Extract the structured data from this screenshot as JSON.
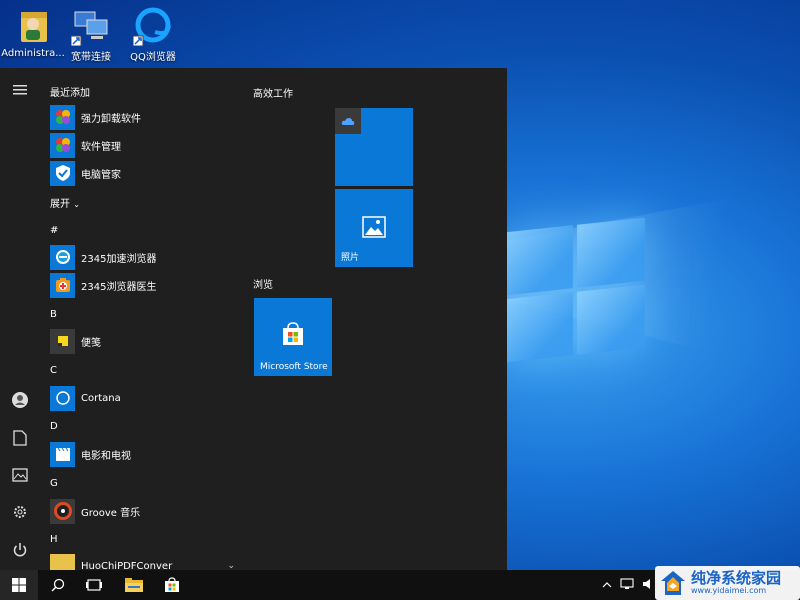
{
  "desktop": {
    "icons": [
      {
        "label": "Administra...",
        "icon": "user-folder-icon"
      },
      {
        "label": "宽带连接",
        "icon": "network-icon"
      },
      {
        "label": "QQ浏览器",
        "icon": "qq-browser-icon"
      }
    ]
  },
  "start_menu": {
    "rail": {
      "items": [
        "hamburger-menu-icon",
        "user-icon",
        "documents-icon",
        "pictures-icon",
        "settings-icon",
        "power-icon"
      ]
    },
    "app_list": {
      "recent_header": "最近添加",
      "recent": [
        {
          "label": "强力卸载软件",
          "icon": "uninstaller-icon"
        },
        {
          "label": "软件管理",
          "icon": "software-manager-icon"
        },
        {
          "label": "电脑管家",
          "icon": "pc-manager-icon"
        }
      ],
      "expand_label": "展开",
      "groups": [
        {
          "letter": "#",
          "apps": [
            {
              "label": "2345加速浏览器",
              "icon": "2345-browser-icon"
            },
            {
              "label": "2345浏览器医生",
              "icon": "browser-doctor-icon"
            }
          ]
        },
        {
          "letter": "B",
          "apps": [
            {
              "label": "便笺",
              "icon": "sticky-notes-icon"
            }
          ]
        },
        {
          "letter": "C",
          "apps": [
            {
              "label": "Cortana",
              "icon": "cortana-icon"
            }
          ]
        },
        {
          "letter": "D",
          "apps": [
            {
              "label": "电影和电视",
              "icon": "movies-tv-icon"
            }
          ]
        },
        {
          "letter": "G",
          "apps": [
            {
              "label": "Groove 音乐",
              "icon": "groove-music-icon"
            }
          ]
        },
        {
          "letter": "H",
          "apps": [
            {
              "label": "HuoChiPDFConver",
              "icon": "pdf-converter-icon"
            }
          ]
        }
      ]
    },
    "tiles": {
      "groups": [
        {
          "title": "高效工作",
          "tiles": [
            {
              "label": "",
              "icon": "onedrive-icon"
            },
            {
              "label": "照片",
              "icon": "photos-icon"
            }
          ]
        },
        {
          "title": "浏览",
          "tiles": [
            {
              "label": "Microsoft Store",
              "icon": "store-icon"
            }
          ]
        }
      ]
    }
  },
  "taskbar": {
    "items": [
      "windows-start-icon",
      "search-icon",
      "task-view-icon",
      "file-explorer-icon",
      "store-icon"
    ],
    "tray": [
      "chevron-up-icon",
      "network-icon",
      "volume-icon"
    ]
  },
  "watermark": {
    "title": "纯净系统家园",
    "url": "www.yidaimei.com"
  },
  "colors": {
    "tile_blue": "#0a78d7",
    "start_bg": "#1f1f1f",
    "taskbar_bg": "#101010"
  }
}
